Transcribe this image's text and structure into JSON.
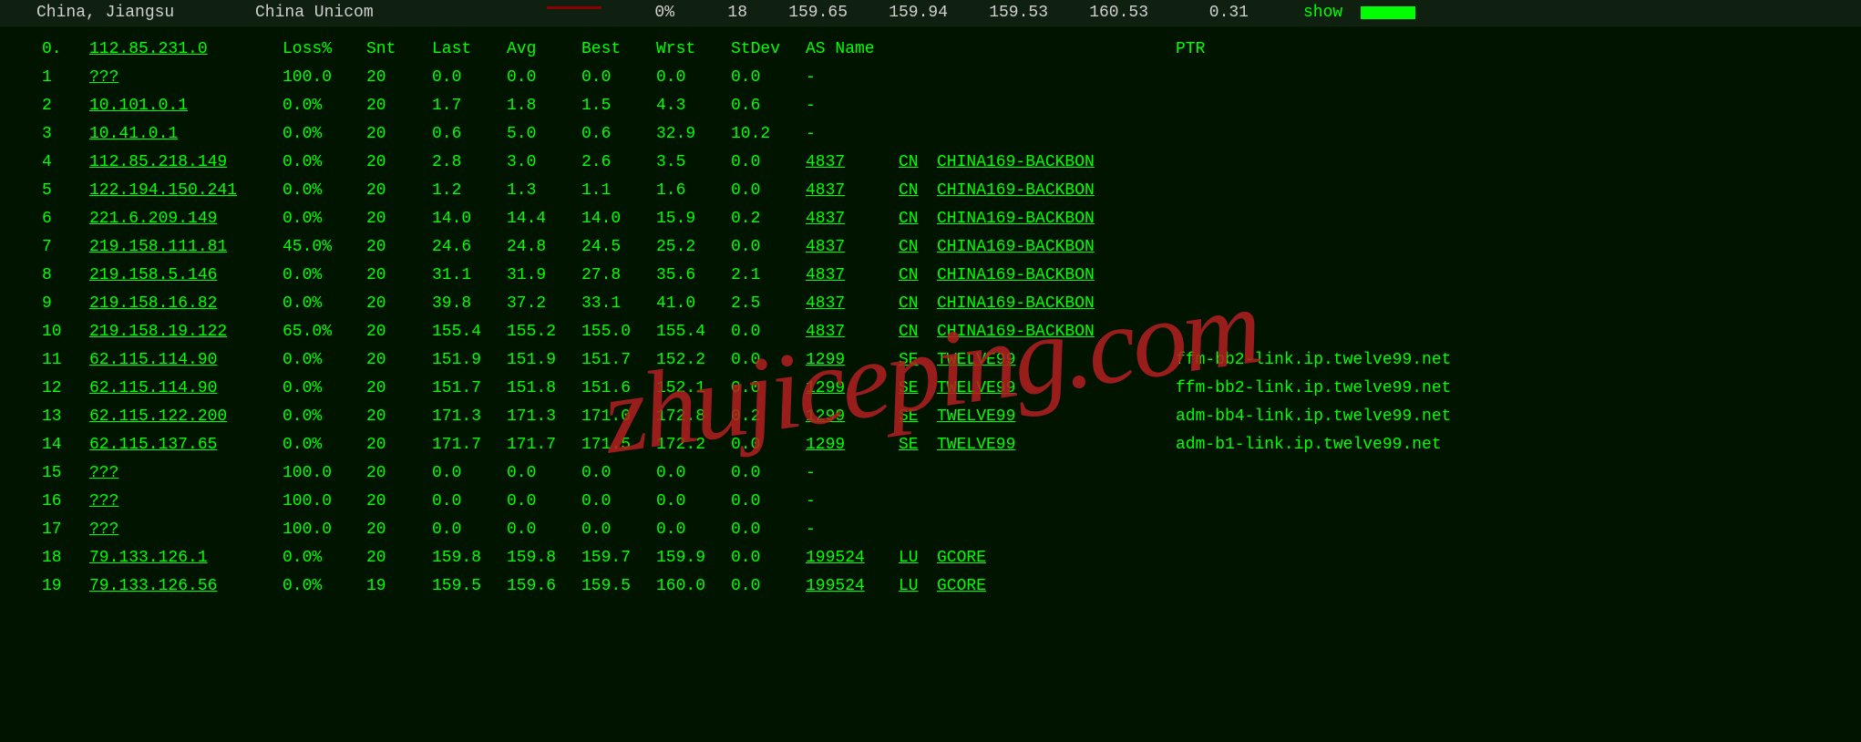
{
  "topbar": {
    "location": "China, Jiangsu",
    "isp": "China Unicom",
    "pct": "0%",
    "snt": "18",
    "last": "159.65",
    "avg": "159.94",
    "best": "159.53",
    "wrst": "160.53",
    "stdev": "0.31",
    "show": "show"
  },
  "columns": {
    "hop": "0.",
    "ip": "112.85.231.0",
    "loss": "Loss%",
    "snt": "Snt",
    "last": "Last",
    "avg": "Avg",
    "best": "Best",
    "wrst": "Wrst",
    "stdev": "StDev",
    "asname": "AS Name",
    "ptr": "PTR"
  },
  "hops": [
    {
      "n": "1",
      "ip": "???",
      "loss": "100.0",
      "snt": "20",
      "last": "0.0",
      "avg": "0.0",
      "best": "0.0",
      "wrst": "0.0",
      "stdev": "0.0",
      "asn": "",
      "cc": "",
      "asname": "-",
      "ptr": ""
    },
    {
      "n": "2",
      "ip": "10.101.0.1",
      "loss": "0.0%",
      "snt": "20",
      "last": "1.7",
      "avg": "1.8",
      "best": "1.5",
      "wrst": "4.3",
      "stdev": "0.6",
      "asn": "",
      "cc": "",
      "asname": "-",
      "ptr": ""
    },
    {
      "n": "3",
      "ip": "10.41.0.1",
      "loss": "0.0%",
      "snt": "20",
      "last": "0.6",
      "avg": "5.0",
      "best": "0.6",
      "wrst": "32.9",
      "stdev": "10.2",
      "asn": "",
      "cc": "",
      "asname": "-",
      "ptr": ""
    },
    {
      "n": "4",
      "ip": "112.85.218.149",
      "loss": "0.0%",
      "snt": "20",
      "last": "2.8",
      "avg": "3.0",
      "best": "2.6",
      "wrst": "3.5",
      "stdev": "0.0",
      "asn": "4837",
      "cc": "CN",
      "asname": "CHINA169-BACKBON",
      "ptr": ""
    },
    {
      "n": "5",
      "ip": "122.194.150.241",
      "loss": "0.0%",
      "snt": "20",
      "last": "1.2",
      "avg": "1.3",
      "best": "1.1",
      "wrst": "1.6",
      "stdev": "0.0",
      "asn": "4837",
      "cc": "CN",
      "asname": "CHINA169-BACKBON",
      "ptr": ""
    },
    {
      "n": "6",
      "ip": "221.6.209.149",
      "loss": "0.0%",
      "snt": "20",
      "last": "14.0",
      "avg": "14.4",
      "best": "14.0",
      "wrst": "15.9",
      "stdev": "0.2",
      "asn": "4837",
      "cc": "CN",
      "asname": "CHINA169-BACKBON",
      "ptr": ""
    },
    {
      "n": "7",
      "ip": "219.158.111.81",
      "loss": "45.0%",
      "snt": "20",
      "last": "24.6",
      "avg": "24.8",
      "best": "24.5",
      "wrst": "25.2",
      "stdev": "0.0",
      "asn": "4837",
      "cc": "CN",
      "asname": "CHINA169-BACKBON",
      "ptr": ""
    },
    {
      "n": "8",
      "ip": "219.158.5.146",
      "loss": "0.0%",
      "snt": "20",
      "last": "31.1",
      "avg": "31.9",
      "best": "27.8",
      "wrst": "35.6",
      "stdev": "2.1",
      "asn": "4837",
      "cc": "CN",
      "asname": "CHINA169-BACKBON",
      "ptr": ""
    },
    {
      "n": "9",
      "ip": "219.158.16.82",
      "loss": "0.0%",
      "snt": "20",
      "last": "39.8",
      "avg": "37.2",
      "best": "33.1",
      "wrst": "41.0",
      "stdev": "2.5",
      "asn": "4837",
      "cc": "CN",
      "asname": "CHINA169-BACKBON",
      "ptr": ""
    },
    {
      "n": "10",
      "ip": "219.158.19.122",
      "loss": "65.0%",
      "snt": "20",
      "last": "155.4",
      "avg": "155.2",
      "best": "155.0",
      "wrst": "155.4",
      "stdev": "0.0",
      "asn": "4837",
      "cc": "CN",
      "asname": "CHINA169-BACKBON",
      "ptr": ""
    },
    {
      "n": "11",
      "ip": "62.115.114.90",
      "loss": "0.0%",
      "snt": "20",
      "last": "151.9",
      "avg": "151.9",
      "best": "151.7",
      "wrst": "152.2",
      "stdev": "0.0",
      "asn": "1299",
      "cc": "SE",
      "asname": "TWELVE99",
      "ptr": "ffm-bb2-link.ip.twelve99.net"
    },
    {
      "n": "12",
      "ip": "62.115.114.90",
      "loss": "0.0%",
      "snt": "20",
      "last": "151.7",
      "avg": "151.8",
      "best": "151.6",
      "wrst": "152.1",
      "stdev": "0.0",
      "asn": "1299",
      "cc": "SE",
      "asname": "TWELVE99",
      "ptr": "ffm-bb2-link.ip.twelve99.net"
    },
    {
      "n": "13",
      "ip": "62.115.122.200",
      "loss": "0.0%",
      "snt": "20",
      "last": "171.3",
      "avg": "171.3",
      "best": "171.0",
      "wrst": "172.8",
      "stdev": "0.2",
      "asn": "1299",
      "cc": "SE",
      "asname": "TWELVE99",
      "ptr": "adm-bb4-link.ip.twelve99.net"
    },
    {
      "n": "14",
      "ip": "62.115.137.65",
      "loss": "0.0%",
      "snt": "20",
      "last": "171.7",
      "avg": "171.7",
      "best": "171.5",
      "wrst": "172.2",
      "stdev": "0.0",
      "asn": "1299",
      "cc": "SE",
      "asname": "TWELVE99",
      "ptr": "adm-b1-link.ip.twelve99.net"
    },
    {
      "n": "15",
      "ip": "???",
      "loss": "100.0",
      "snt": "20",
      "last": "0.0",
      "avg": "0.0",
      "best": "0.0",
      "wrst": "0.0",
      "stdev": "0.0",
      "asn": "",
      "cc": "",
      "asname": "-",
      "ptr": ""
    },
    {
      "n": "16",
      "ip": "???",
      "loss": "100.0",
      "snt": "20",
      "last": "0.0",
      "avg": "0.0",
      "best": "0.0",
      "wrst": "0.0",
      "stdev": "0.0",
      "asn": "",
      "cc": "",
      "asname": "-",
      "ptr": ""
    },
    {
      "n": "17",
      "ip": "???",
      "loss": "100.0",
      "snt": "20",
      "last": "0.0",
      "avg": "0.0",
      "best": "0.0",
      "wrst": "0.0",
      "stdev": "0.0",
      "asn": "",
      "cc": "",
      "asname": "-",
      "ptr": ""
    },
    {
      "n": "18",
      "ip": "79.133.126.1",
      "loss": "0.0%",
      "snt": "20",
      "last": "159.8",
      "avg": "159.8",
      "best": "159.7",
      "wrst": "159.9",
      "stdev": "0.0",
      "asn": "199524",
      "cc": "LU",
      "asname": "GCORE",
      "ptr": ""
    },
    {
      "n": "19",
      "ip": "79.133.126.56",
      "loss": "0.0%",
      "snt": "19",
      "last": "159.5",
      "avg": "159.6",
      "best": "159.5",
      "wrst": "160.0",
      "stdev": "0.0",
      "asn": "199524",
      "cc": "LU",
      "asname": "GCORE",
      "ptr": ""
    }
  ],
  "watermark": "zhujiceping.com"
}
